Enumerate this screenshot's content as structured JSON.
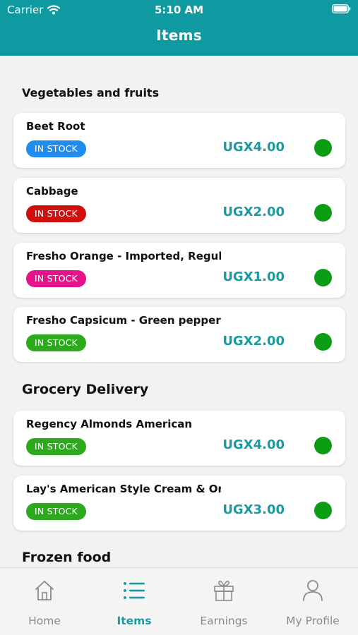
{
  "status_bar": {
    "carrier": "Carrier",
    "time": "5:10 AM"
  },
  "header": {
    "title": "Items"
  },
  "sections": [
    {
      "title": "Vegetables and fruits",
      "items": [
        {
          "name": "Beet Root",
          "badge": "IN STOCK",
          "badge_color": "#1f8cf0",
          "price": "UGX4.00"
        },
        {
          "name": "Cabbage",
          "badge": "IN STOCK",
          "badge_color": "#d10f0f",
          "price": "UGX2.00"
        },
        {
          "name": "Fresho Orange - Imported, Regular,",
          "badge": "IN STOCK",
          "badge_color": "#e6128c",
          "price": "UGX1.00"
        },
        {
          "name": "Fresho Capsicum - Green pepper",
          "badge": "IN STOCK",
          "badge_color": "#2bab1c",
          "price": "UGX2.00"
        }
      ]
    },
    {
      "title": "Grocery Delivery",
      "items": [
        {
          "name": "Regency Almonds American",
          "badge": "IN STOCK",
          "badge_color": "#2bab1c",
          "price": "UGX4.00"
        },
        {
          "name": "Lay's American Style Cream & Onion",
          "badge": "IN STOCK",
          "badge_color": "#2bab1c",
          "price": "UGX3.00"
        }
      ]
    },
    {
      "title": "Frozen food",
      "items": []
    }
  ],
  "colors": {
    "accent": "#0e9aa0",
    "price": "#1b9aa2",
    "status_dot": "#0b9d14"
  },
  "tabbar": {
    "tabs": [
      {
        "label": "Home",
        "icon": "home-icon"
      },
      {
        "label": "Items",
        "icon": "list-icon",
        "active": true
      },
      {
        "label": "Earnings",
        "icon": "gift-icon"
      },
      {
        "label": "My Profile",
        "icon": "person-icon"
      }
    ]
  }
}
